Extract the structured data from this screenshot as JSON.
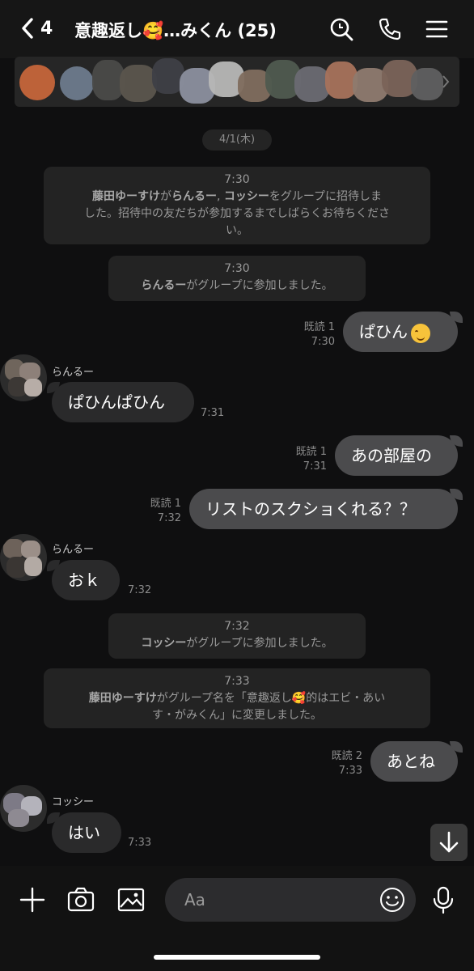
{
  "header": {
    "back_count": "4",
    "title": "意趣返し🥰…みくん (25)",
    "icons": [
      "chevron-left-icon",
      "search-icon",
      "phone-icon",
      "menu-icon"
    ]
  },
  "date_pill": "4/1(木)",
  "system_messages": [
    {
      "time": "7:30",
      "line1_a": "藤田ゆーすけ",
      "line1_b": "が",
      "line1_c": "らんるー",
      "line1_d": ", ",
      "line1_e": "コッシー",
      "line1_f": "をグループに招待しま",
      "line2": "した。招待中の友だちが参加するまでしばらくお待ちくださ",
      "line3": "い。"
    },
    {
      "time": "7:30",
      "name": "らんるー",
      "text": "がグループに参加しました。"
    },
    {
      "time": "7:32",
      "name": "コッシー",
      "text": "がグループに参加しました。"
    },
    {
      "time": "7:33",
      "name": "藤田ゆーすけ",
      "line1": "がグループ名を「意趣返し🥰的はエビ・あい",
      "line2": "す・がみくん」に変更しました。"
    }
  ],
  "messages": [
    {
      "dir": "out",
      "text": "ぱひん",
      "read": "既読 1",
      "time": "7:30",
      "emoji": "smiling-emoji"
    },
    {
      "dir": "in",
      "sender": "らんるー",
      "text": "ぱひんぱひん",
      "time": "7:31"
    },
    {
      "dir": "out",
      "text": "あの部屋の",
      "read": "既読 1",
      "time": "7:31"
    },
    {
      "dir": "out",
      "text": "リストのスクショくれる？？",
      "read": "既読 1",
      "time": "7:32"
    },
    {
      "dir": "in",
      "sender": "らんるー",
      "text": "おｋ",
      "time": "7:32"
    },
    {
      "dir": "out",
      "text": "あとね",
      "read": "既読 2",
      "time": "7:33"
    },
    {
      "dir": "in",
      "sender": "コッシー",
      "text": "はい",
      "time": "7:33"
    }
  ],
  "input": {
    "placeholder": "Aa"
  },
  "colors": {
    "background": "#0f0f10",
    "bubble_out": "#4b4b4d",
    "bubble_in": "#2a2a2b",
    "system": "#232323"
  }
}
